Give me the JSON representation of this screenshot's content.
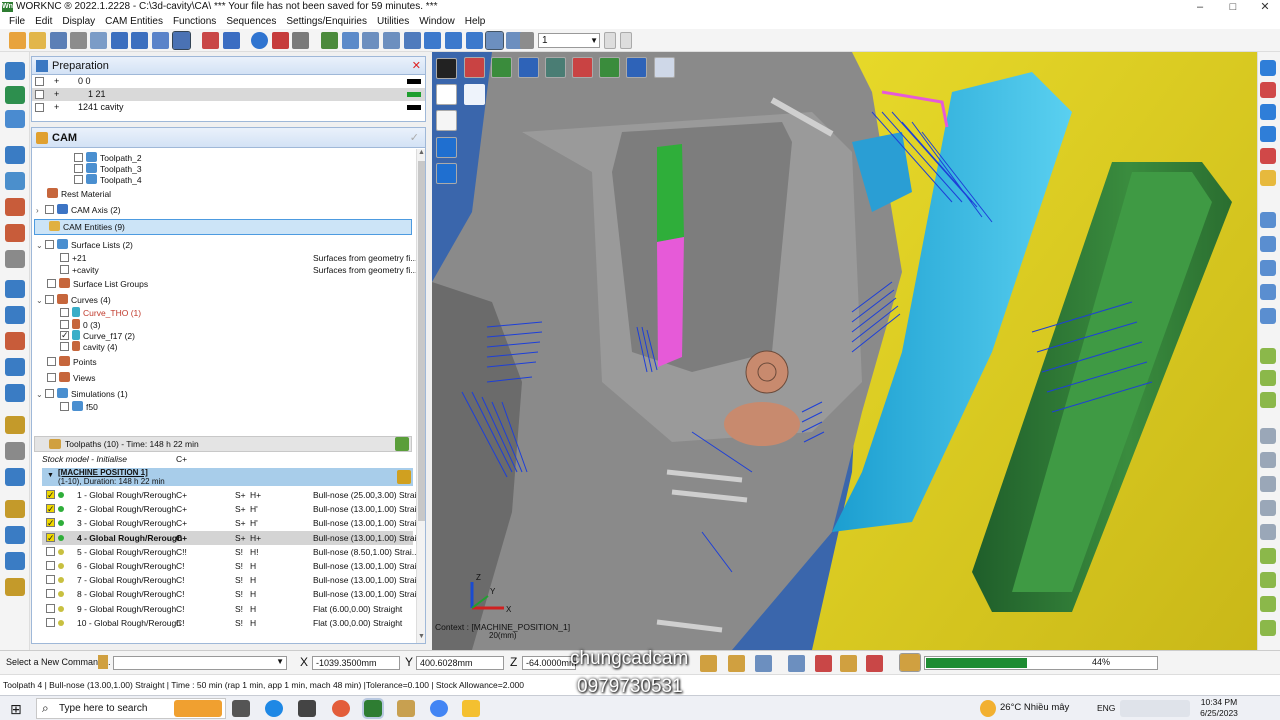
{
  "titlebar": {
    "app_icon": "Wn",
    "title": "WORKNC ® 2022.1.2228 - C:\\3d-cavity\\CA\\ *** Your file has not been saved for 59 minutes. ***",
    "min": "–",
    "max": "□",
    "close": "✕"
  },
  "menu": [
    "File",
    "Edit",
    "Display",
    "CAM Entities",
    "Functions",
    "Sequences",
    "Settings/Enquiries",
    "Utilities",
    "Window",
    "Help"
  ],
  "toolbar": {
    "combo_value": "1"
  },
  "preparation": {
    "title": "Preparation",
    "rows": [
      {
        "state": "+",
        "label": "0  0",
        "swatch": "#000000"
      },
      {
        "state": "+",
        "label": "1  21",
        "swatch": "#1e9e2e"
      },
      {
        "state": "+",
        "label": "1241  cavity",
        "swatch": "#000000"
      }
    ]
  },
  "cam": {
    "title": "CAM",
    "tree": [
      {
        "label": "Toolpath_2"
      },
      {
        "label": "Toolpath_3"
      },
      {
        "label": "Toolpath_4"
      },
      {
        "label": "Rest Material"
      },
      {
        "label": "CAM Axis (2)"
      },
      {
        "label": "CAM Entities (9)"
      },
      {
        "label": "Surface Lists (2)"
      },
      {
        "label": "+21",
        "side": "Surfaces from geometry fi..."
      },
      {
        "label": "+cavity",
        "side": "Surfaces from geometry fi..."
      },
      {
        "label": "Surface List Groups"
      },
      {
        "label": "Curves (4)"
      },
      {
        "label": "Curve_THO (1)"
      },
      {
        "label": "0 (3)"
      },
      {
        "label": "Curve_f17 (2)"
      },
      {
        "label": "cavity (4)"
      },
      {
        "label": "Points"
      },
      {
        "label": "Views"
      },
      {
        "label": "Simulations (1)"
      },
      {
        "label": "f50"
      }
    ],
    "toolpaths_header": "Toolpaths (10) - Time: 148 h 22 min",
    "stock": {
      "label": "Stock model - Initialise",
      "code": "C+"
    },
    "machine": {
      "title": "[MACHINE POSITION 1]",
      "sub": "(1-10), Duration: 148 h 22 min"
    },
    "toolpaths": [
      {
        "name": "1 - Global Rough/Rerough",
        "c": "C+",
        "s": "S+",
        "h": "H+",
        "tool": "Bull-nose (25.00,3.00) Strai...",
        "checked": true,
        "dot": "#2fae3a"
      },
      {
        "name": "2 - Global Rough/Rerough",
        "c": "C+",
        "s": "S+",
        "h": "H'",
        "tool": "Bull-nose (13.00,1.00) Strai...",
        "checked": true,
        "dot": "#2fae3a"
      },
      {
        "name": "3 - Global Rough/Rerough",
        "c": "C+",
        "s": "S+",
        "h": "H'",
        "tool": "Bull-nose (13.00,1.00) Strai...",
        "checked": true,
        "dot": "#2fae3a"
      },
      {
        "name": "4 - Global Rough/Rerough",
        "c": "C+",
        "s": "S+",
        "h": "H+",
        "tool": "Bull-nose (13.00,1.00) Strai...",
        "checked": true,
        "dot": "#2fae3a"
      },
      {
        "name": "5 - Global Rough/Rerough",
        "c": "C!!",
        "s": "S!",
        "h": "H!",
        "tool": "Bull-nose (8.50,1.00) Strai...",
        "checked": false,
        "dot": "#c8c040"
      },
      {
        "name": "6 - Global Rough/Rerough",
        "c": "C!",
        "s": "S!",
        "h": "H",
        "tool": "Bull-nose (13.00,1.00) Strai...",
        "checked": false,
        "dot": "#c8c040"
      },
      {
        "name": "7 - Global Rough/Rerough",
        "c": "C!",
        "s": "S!",
        "h": "H",
        "tool": "Bull-nose (13.00,1.00) Strai...",
        "checked": false,
        "dot": "#c8c040"
      },
      {
        "name": "8 - Global Rough/Rerough",
        "c": "C!",
        "s": "S!",
        "h": "H",
        "tool": "Bull-nose (13.00,1.00) Strai...",
        "checked": false,
        "dot": "#c8c040"
      },
      {
        "name": "9 - Global Rough/Rerough",
        "c": "C!",
        "s": "S!",
        "h": "H",
        "tool": "Flat (6.00,0.00) Straight",
        "checked": false,
        "dot": "#c8c040"
      },
      {
        "name": "10 - Global Rough/Rerough",
        "c": "C!",
        "s": "S!",
        "h": "H",
        "tool": "Flat (3.00,0.00) Straight",
        "checked": false,
        "dot": "#c8c040"
      }
    ]
  },
  "viewport": {
    "context": "Context : [MACHINE_POSITION_1]",
    "scale": "20(mm)",
    "axes": [
      "X",
      "Y",
      "Z"
    ]
  },
  "command": {
    "label": "Select a New Command...",
    "x_label": "X",
    "x_value": "-1039.3500mm",
    "y_label": "Y",
    "y_value": "400.6028mm",
    "z_label": "Z",
    "z_value": "-64.0000mm",
    "progress": 0.44,
    "progress_text": "44%"
  },
  "status": "Toolpath 4 | Bull-nose (13.00,1.00) Straight | Time : 50 min (rap 1 min, app 1 min, mach 48 min) |Tolerance=0.100 | Stock Allowance=2.000",
  "watermark": {
    "line1": "chungcadcam",
    "line2": "0979730531"
  },
  "taskbar": {
    "search_placeholder": "Type here to search",
    "weather": "26°C  Nhiều mây",
    "lang": "ENG",
    "time": "10:34 PM",
    "date": "6/25/2023"
  },
  "colors": {
    "accent": "#3b78c2",
    "progress": "#1e8c32",
    "selection": "#cce4f7",
    "machine_row": "#a8cdea"
  }
}
